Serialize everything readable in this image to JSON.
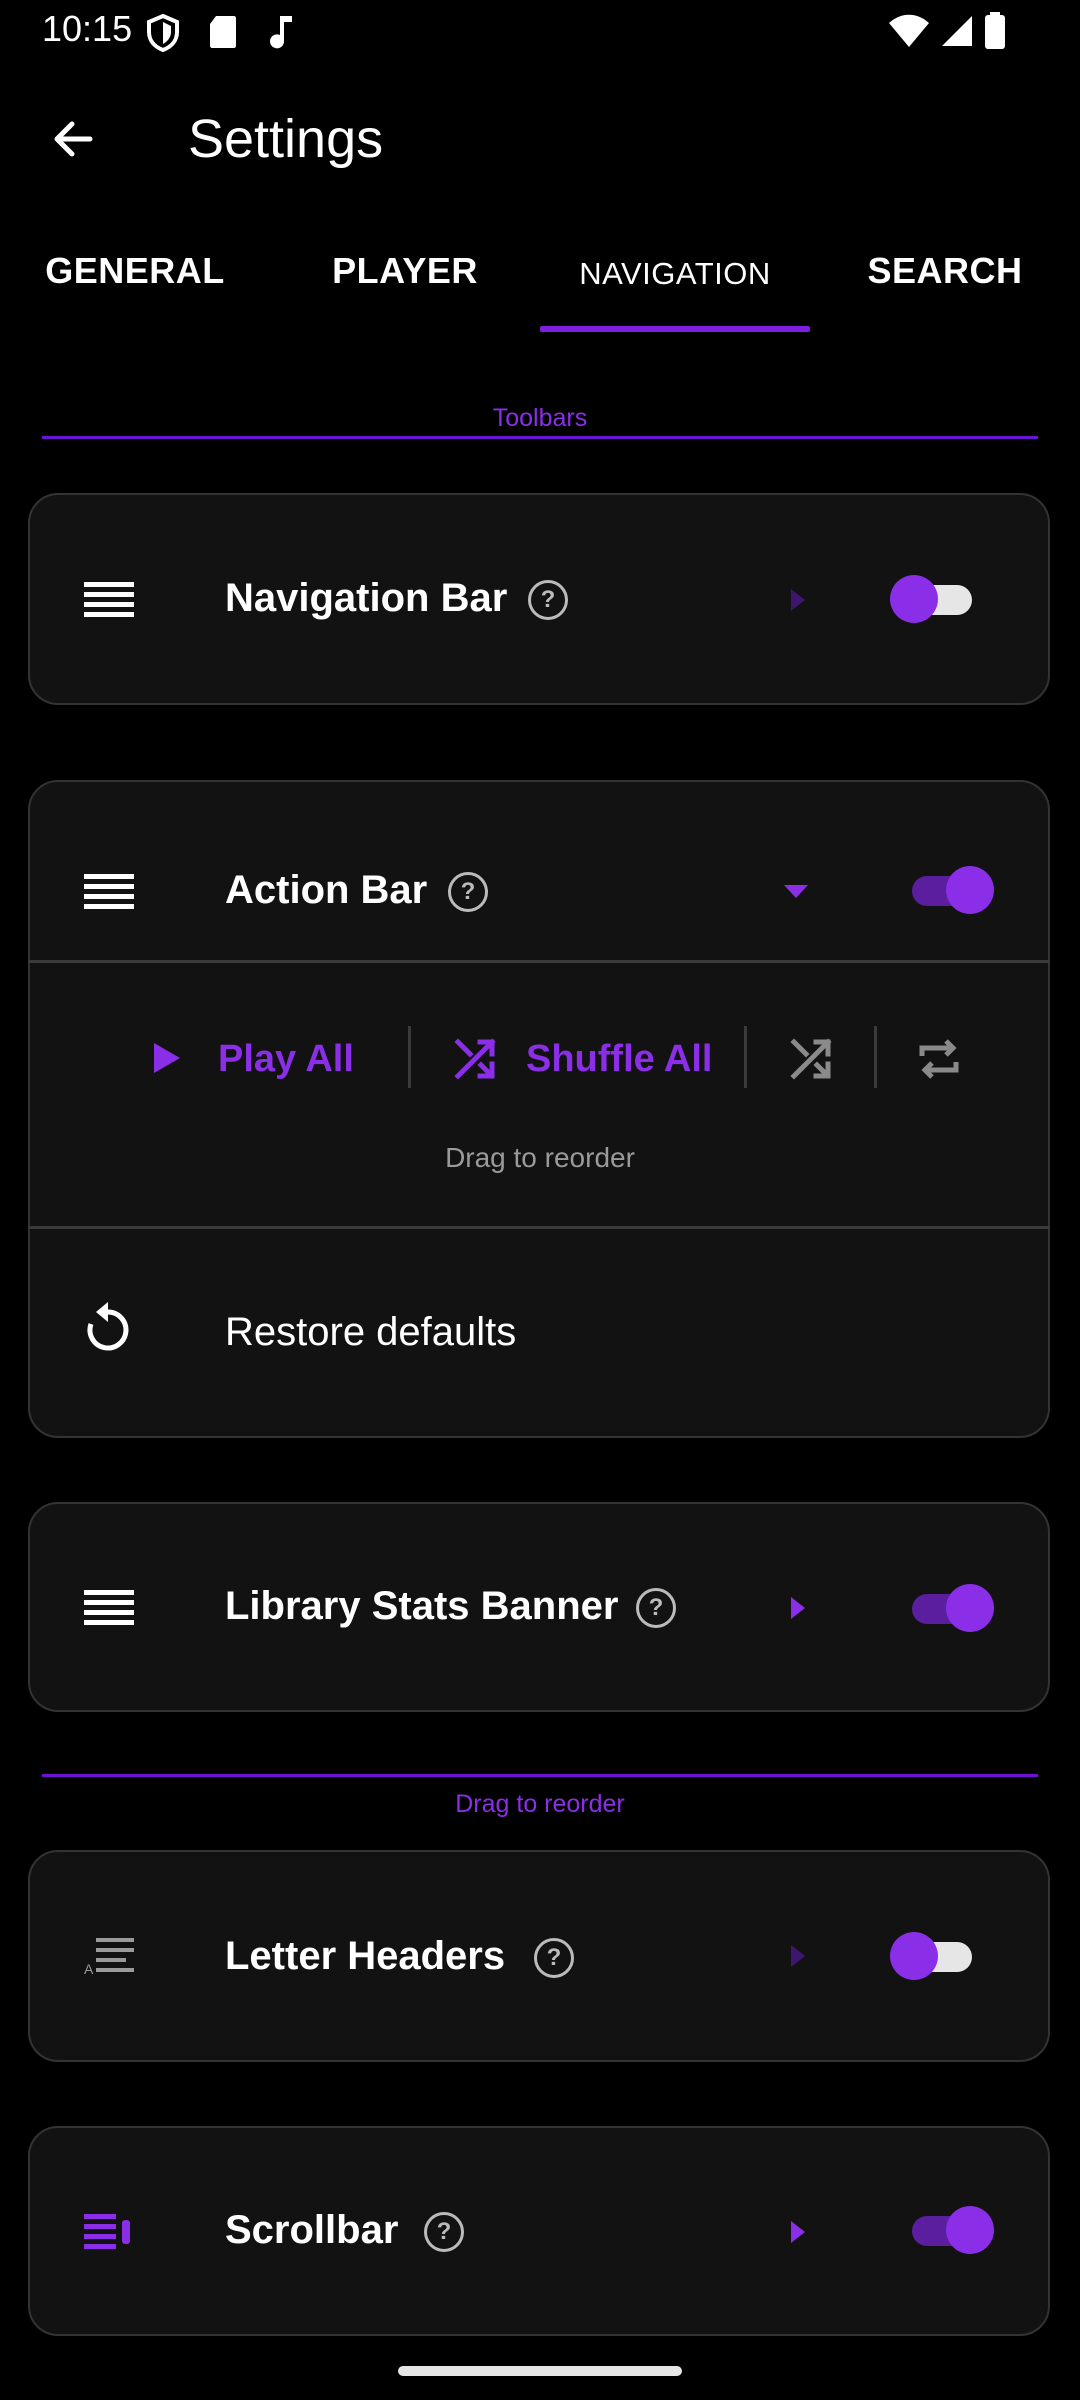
{
  "status_bar": {
    "time": "10:15"
  },
  "app_bar": {
    "title": "Settings"
  },
  "tabs": [
    {
      "label": "GENERAL"
    },
    {
      "label": "PLAYER"
    },
    {
      "label": "NAVIGATION",
      "selected": true
    },
    {
      "label": "SEARCH"
    }
  ],
  "sections": {
    "toolbars": "Toolbars",
    "drag_to_reorder": "Drag to reorder"
  },
  "items": {
    "navigation_bar": {
      "title": "Navigation Bar",
      "enabled": true,
      "expanded": false
    },
    "action_bar": {
      "title": "Action Bar",
      "enabled": true,
      "expanded": true,
      "actions": [
        {
          "label": "Play All",
          "icon": "play-icon"
        },
        {
          "label": "Shuffle All",
          "icon": "shuffle-icon"
        },
        {
          "label": "",
          "icon": "shuffle-icon",
          "active": false
        },
        {
          "label": "",
          "icon": "repeat-icon",
          "active": false
        }
      ],
      "drag_hint": "Drag to reorder",
      "restore_label": "Restore defaults"
    },
    "library_stats_banner": {
      "title": "Library Stats Banner",
      "enabled": true,
      "expanded": false
    },
    "letter_headers": {
      "title": "Letter Headers",
      "enabled": true,
      "expanded": false
    },
    "scrollbar": {
      "title": "Scrollbar",
      "enabled": true,
      "expanded": false
    }
  },
  "colors": {
    "accent": "#8b2ee8",
    "background": "#000000",
    "card": "#121212"
  }
}
